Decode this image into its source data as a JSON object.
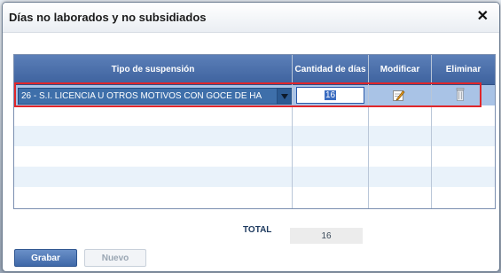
{
  "dialog": {
    "title": "Días no laborados y no subsidiados",
    "close_symbol": "✕"
  },
  "table": {
    "columns": [
      "Tipo de suspensión",
      "Cantidad de días",
      "Modificar",
      "Eliminar"
    ],
    "rows": [
      {
        "tipo": "26 - S.I. LICENCIA U OTROS MOTIVOS CON GOCE DE HA",
        "cantidad": "16"
      }
    ]
  },
  "footer": {
    "total_label": "TOTAL",
    "total_value": "16"
  },
  "buttons": {
    "grabar": "Grabar",
    "nuevo": "Nuevo"
  },
  "colors": {
    "header": "#4a70ad",
    "selected_row": "#a9c3e6",
    "highlight_border": "#e0262a"
  },
  "icons": {
    "close": "close-icon",
    "edit": "edit-pencil-icon",
    "delete": "trash-icon",
    "dropdown": "chevron-down-icon"
  }
}
